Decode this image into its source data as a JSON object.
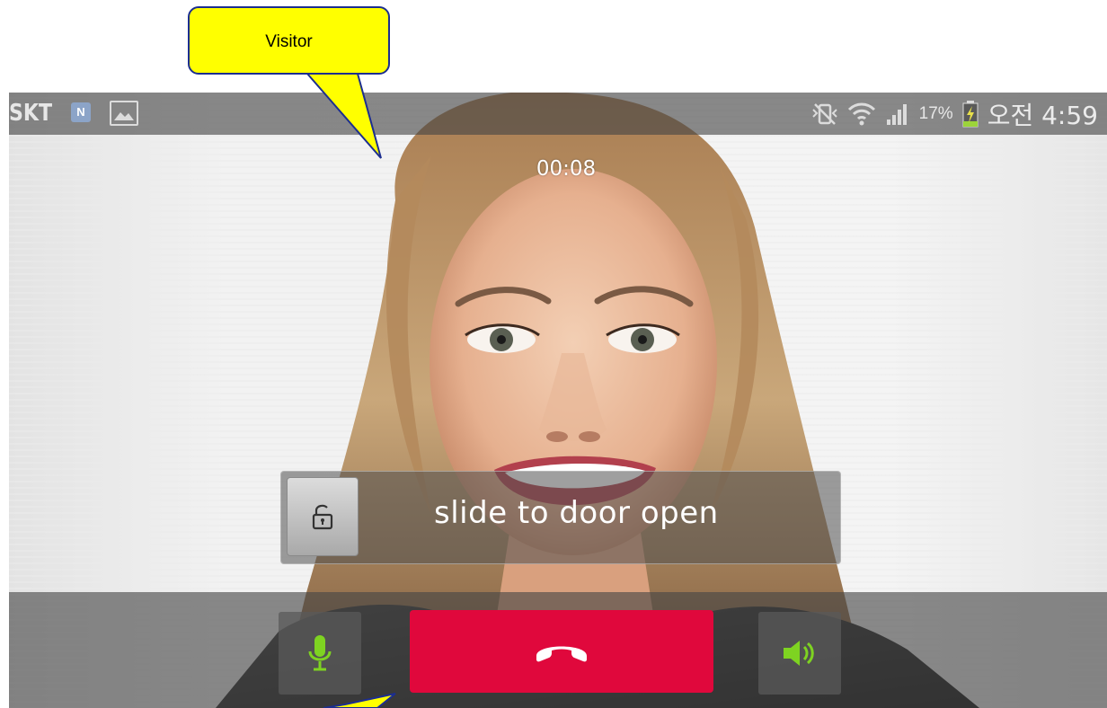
{
  "annotation": {
    "callout_label": "Visitor"
  },
  "status_bar": {
    "carrier": "SKT",
    "notification_badge": "N",
    "battery_percent": "17%",
    "clock": "오전 4:59",
    "icons": [
      "carrier-label",
      "naver-notification-icon",
      "gallery-notification-icon",
      "vibrate-mute-icon",
      "wifi-icon",
      "signal-icon",
      "battery-charging-icon"
    ]
  },
  "call": {
    "timer": "00:08"
  },
  "door_slider": {
    "label": "slide to door open",
    "handle_icon": "unlock-icon"
  },
  "controls": {
    "mic_icon": "microphone-icon",
    "end_icon": "end-call-icon",
    "speaker_icon": "speaker-icon",
    "end_color": "#e0083c",
    "accent_color": "#7ed321"
  }
}
